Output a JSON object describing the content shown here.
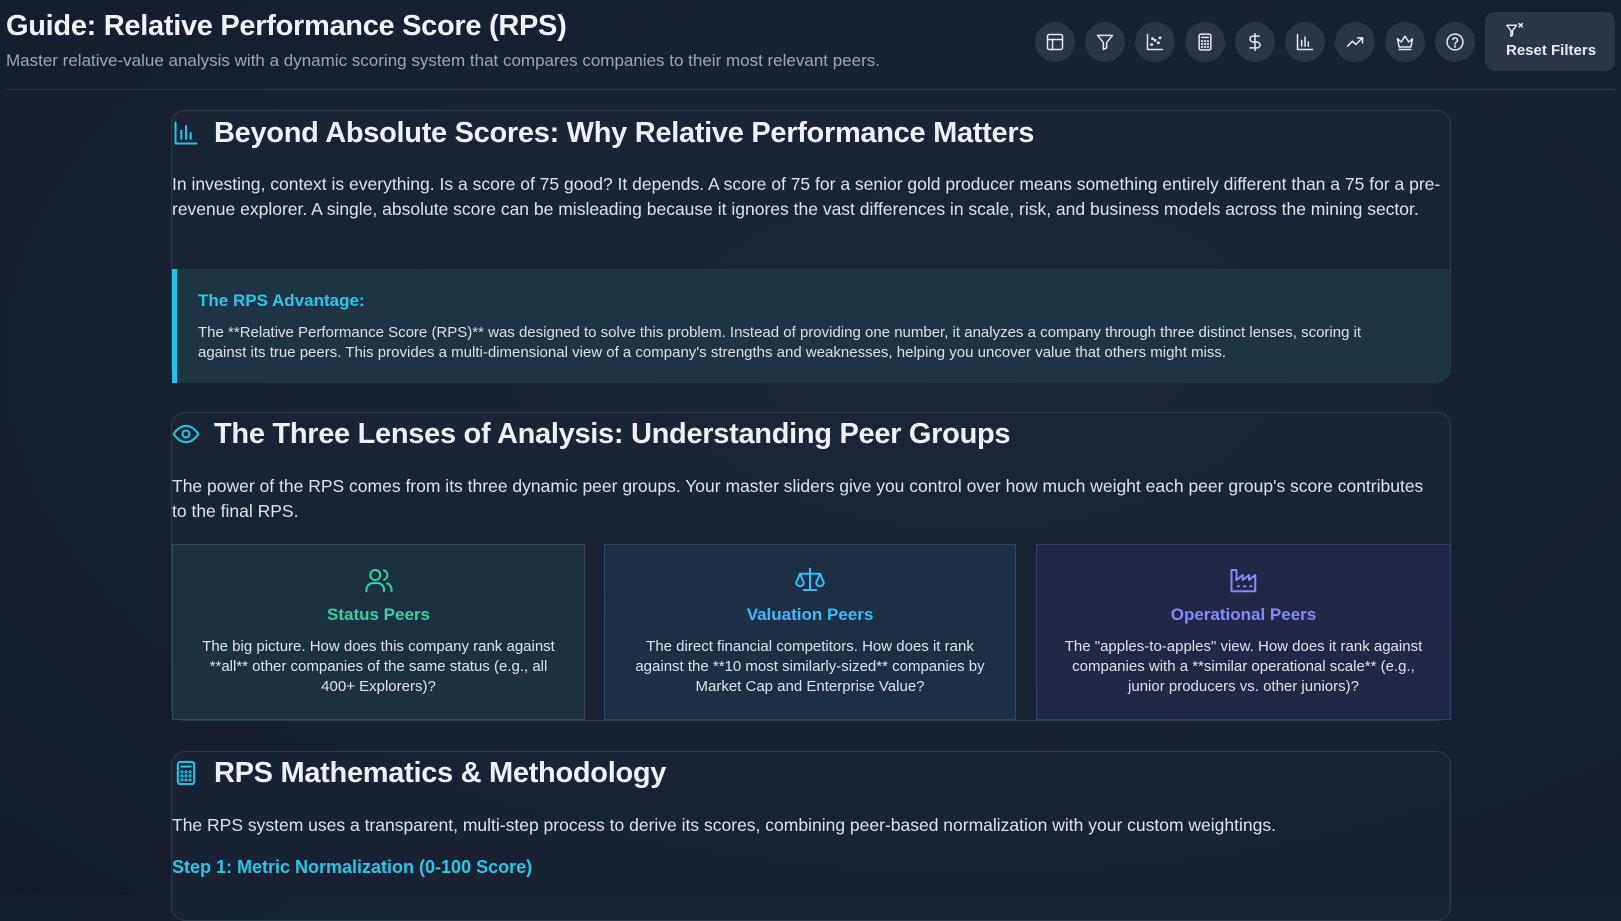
{
  "header": {
    "title": "Guide: Relative Performance Score (RPS)",
    "subtitle": "Master relative-value analysis with a dynamic scoring system that compares companies to their most relevant peers."
  },
  "toolbar": {
    "buttons": [
      {
        "icon": "table-icon"
      },
      {
        "icon": "filter-icon"
      },
      {
        "icon": "scatter-chart-icon"
      },
      {
        "icon": "calculator-icon"
      },
      {
        "icon": "dollar-icon"
      },
      {
        "icon": "bar-chart-icon"
      },
      {
        "icon": "trending-up-icon"
      },
      {
        "icon": "crown-icon"
      },
      {
        "icon": "help-icon"
      }
    ],
    "reset_label": "Reset Filters"
  },
  "section_absolute": {
    "icon": "bar-chart-icon",
    "title": "Beyond Absolute Scores: Why Relative Performance Matters",
    "body": "In investing, context is everything. Is a score of 75 good? It depends. A score of 75 for a senior gold producer means something entirely different than a 75 for a pre-revenue explorer. A single, absolute score can be misleading because it ignores the vast differences in scale, risk, and business models across the mining sector.",
    "callout_title": "The RPS Advantage:",
    "callout_text": "The **Relative Performance Score (RPS)** was designed to solve this problem. Instead of providing one number, it analyzes a company through three distinct lenses, scoring it against its true peers. This provides a multi-dimensional view of a company's strengths and weaknesses, helping you uncover value that others might miss."
  },
  "section_lenses": {
    "icon": "eye-icon",
    "title": "The Three Lenses of Analysis: Understanding Peer Groups",
    "body": "The power of the RPS comes from its three dynamic peer groups. Your master sliders give you control over how much weight each peer group's score contributes to the final RPS.",
    "peers": [
      {
        "icon": "users-icon",
        "name": "Status Peers",
        "color": "#34d3a0",
        "description": "The big picture. How does this company rank against **all** other companies of the same status (e.g., all 400+ Explorers)?"
      },
      {
        "icon": "scale-icon",
        "name": "Valuation Peers",
        "color": "#38bdf8",
        "description": "The direct financial competitors. How does it rank against the **10 most similarly-sized** companies by Market Cap and Enterprise Value?"
      },
      {
        "icon": "factory-icon",
        "name": "Operational Peers",
        "color": "#818cf8",
        "description": "The \"apples-to-apples\" view. How does it rank against companies with a **similar operational scale** (e.g., junior producers vs. other juniors)?"
      }
    ]
  },
  "section_math": {
    "icon": "calculator-icon",
    "title": "RPS Mathematics & Methodology",
    "body": "The RPS system uses a transparent, multi-step process to derive its scores, combining peer-based normalization with your custom weightings.",
    "step1_title": "Step 1: Metric Normalization (0-100 Score)"
  },
  "colors": {
    "accent_cyan": "#22c4e6",
    "status_green": "#34d3a0",
    "valuation_blue": "#38bdf8",
    "operational_purple": "#818cf8"
  }
}
